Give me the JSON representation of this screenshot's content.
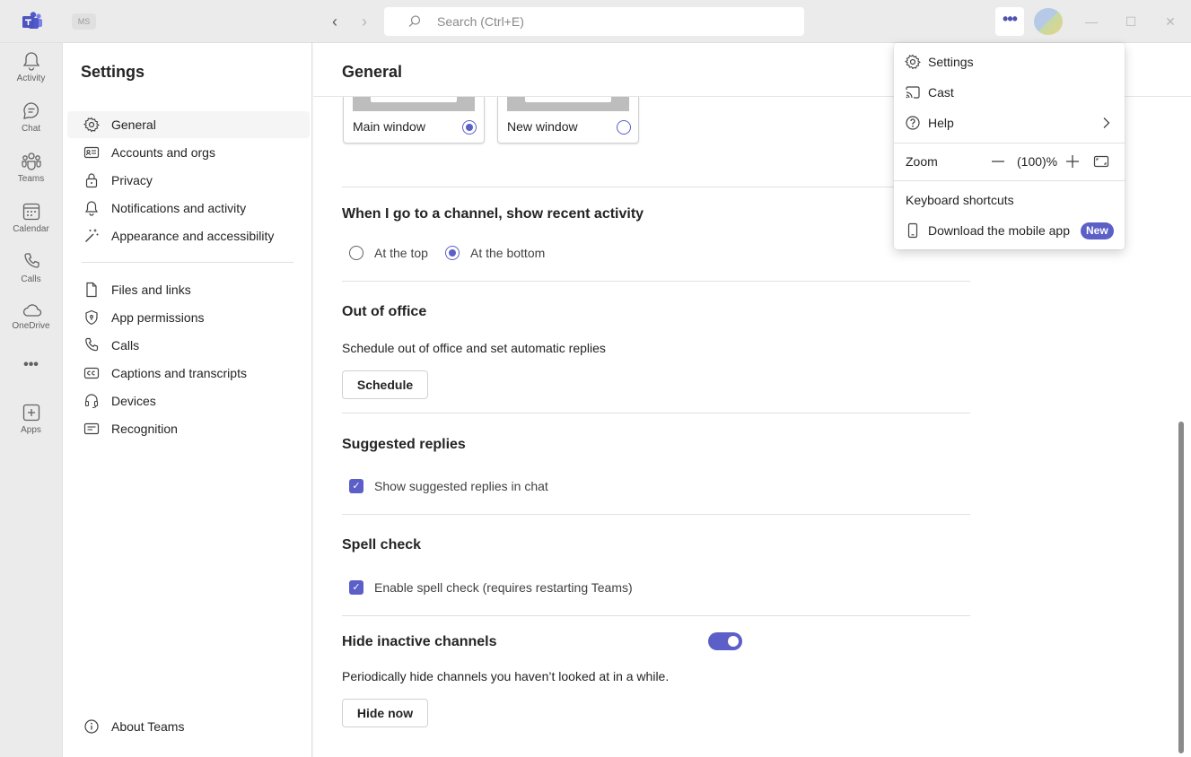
{
  "titlebar": {
    "org_badge": "MS",
    "search_placeholder": "Search (Ctrl+E)",
    "more_label": "•••"
  },
  "rail": {
    "items": [
      {
        "label": "Activity",
        "icon": "bell-icon"
      },
      {
        "label": "Chat",
        "icon": "chat-icon"
      },
      {
        "label": "Teams",
        "icon": "teams-icon"
      },
      {
        "label": "Calendar",
        "icon": "calendar-icon"
      },
      {
        "label": "Calls",
        "icon": "phone-icon"
      },
      {
        "label": "OneDrive",
        "icon": "cloud-icon"
      },
      {
        "label": "•••",
        "icon": "more-icon"
      },
      {
        "label": "Apps",
        "icon": "add-app-icon"
      }
    ]
  },
  "settings": {
    "title": "Settings",
    "nav": [
      {
        "label": "General",
        "icon": "gear-icon",
        "active": true
      },
      {
        "label": "Accounts and orgs",
        "icon": "id-card-icon"
      },
      {
        "label": "Privacy",
        "icon": "lock-icon"
      },
      {
        "label": "Notifications and activity",
        "icon": "bell-icon"
      },
      {
        "label": "Appearance and accessibility",
        "icon": "magic-wand-icon"
      },
      {
        "label": "Files and links",
        "icon": "document-icon"
      },
      {
        "label": "App permissions",
        "icon": "shield-icon"
      },
      {
        "label": "Calls",
        "icon": "phone-icon"
      },
      {
        "label": "Captions and transcripts",
        "icon": "closed-captions-icon"
      },
      {
        "label": "Devices",
        "icon": "headset-icon"
      },
      {
        "label": "Recognition",
        "icon": "recognition-icon"
      }
    ],
    "about": {
      "label": "About Teams",
      "icon": "info-icon"
    }
  },
  "main": {
    "title": "General",
    "window_options": [
      {
        "label": "Main window",
        "selected": true
      },
      {
        "label": "New window",
        "selected": false
      }
    ],
    "channel_activity": {
      "title": "When I go to a channel, show recent activity",
      "options": [
        {
          "label": "At the top",
          "selected": false
        },
        {
          "label": "At the bottom",
          "selected": true
        }
      ]
    },
    "out_of_office": {
      "title": "Out of office",
      "description": "Schedule out of office and set automatic replies",
      "button": "Schedule"
    },
    "suggested_replies": {
      "title": "Suggested replies",
      "checkbox_label": "Show suggested replies in chat",
      "checked": true
    },
    "spell_check": {
      "title": "Spell check",
      "checkbox_label": "Enable spell check (requires restarting Teams)",
      "checked": true
    },
    "hide_inactive": {
      "title": "Hide inactive channels",
      "toggle_on": true,
      "description": "Periodically hide channels you haven’t looked at in a while.",
      "button": "Hide now"
    }
  },
  "menu": {
    "settings": "Settings",
    "cast": "Cast",
    "help": "Help",
    "zoom_label": "Zoom",
    "zoom_value": "(100)%",
    "keyboard_shortcuts": "Keyboard shortcuts",
    "download_app": "Download the mobile app",
    "new_badge": "New"
  },
  "colors": {
    "accent": "#5b5fc7",
    "rail_bg": "#ebebeb",
    "surface": "#ffffff"
  }
}
